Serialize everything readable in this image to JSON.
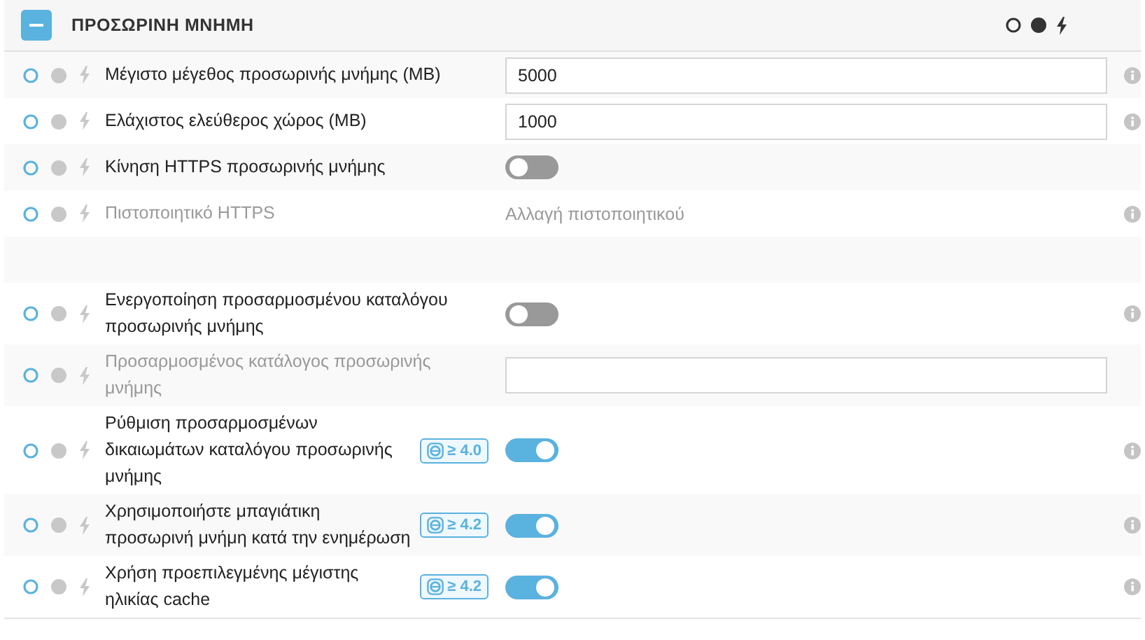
{
  "section": {
    "title": "ΠΡΟΣΩΡΙΝΗ ΜΝΗΜΗ",
    "expanded": true
  },
  "rows": [
    {
      "kind": "input",
      "label": "Μέγιστο μέγεθος προσωρινής μνήμης (MB)",
      "value": "5000",
      "disabled": false,
      "info": true
    },
    {
      "kind": "input",
      "label": "Ελάχιστος ελεύθερος χώρος (MB)",
      "value": "1000",
      "disabled": false,
      "info": true
    },
    {
      "kind": "toggle",
      "label": "Κίνηση HTTPS προσωρινής μνήμης",
      "on": false,
      "disabled": false,
      "info": false
    },
    {
      "kind": "link",
      "label": "Πιστοποιητικό HTTPS",
      "link": "Αλλαγή πιστοποιητικού",
      "disabled": true,
      "info": true
    },
    {
      "kind": "spacer"
    },
    {
      "kind": "toggle",
      "label": "Ενεργοποίηση προσαρμοσμένου καταλόγου προσωρινής μνήμης",
      "on": false,
      "disabled": false,
      "info": true
    },
    {
      "kind": "input",
      "label": "Προσαρμοσμένος κατάλογος προσωρινής μνήμης",
      "value": "",
      "disabled": true,
      "info": false
    },
    {
      "kind": "toggle",
      "label": "Ρύθμιση προσαρμοσμένων δικαιωμάτων καταλόγου προσωρινής μνήμης",
      "badge": "≥ 4.0",
      "on": true,
      "disabled": false,
      "info": true
    },
    {
      "kind": "toggle",
      "label": "Χρησιμοποιήστε μπαγιάτικη προσωρινή μνήμη κατά την ενημέρωση",
      "badge": "≥ 4.2",
      "on": true,
      "disabled": false,
      "info": true
    },
    {
      "kind": "toggle",
      "label": "Χρήση προεπιλεγμένης μέγιστης ηλικίας cache",
      "badge": "≥ 4.2",
      "on": true,
      "disabled": false,
      "info": true
    }
  ]
}
